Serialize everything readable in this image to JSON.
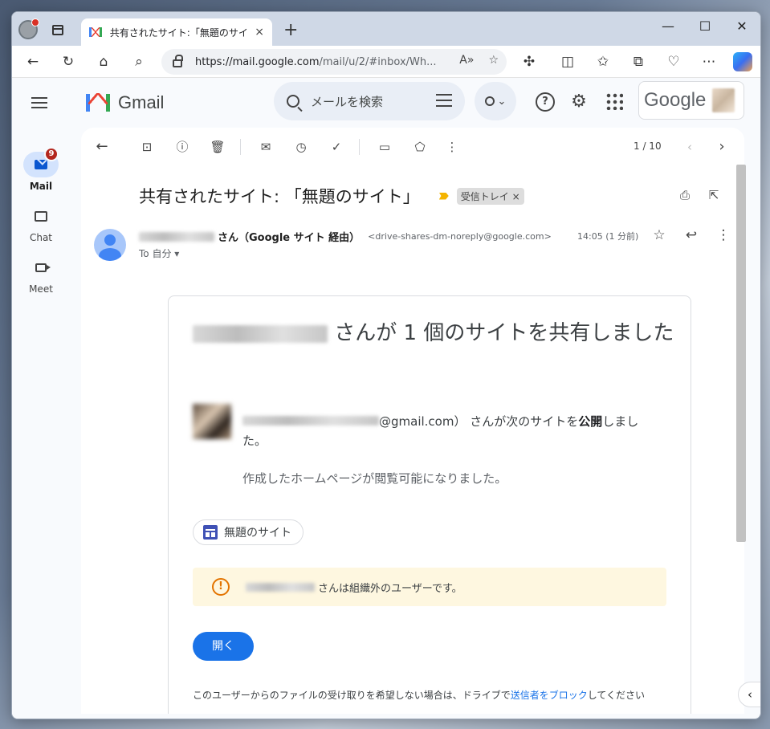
{
  "browser": {
    "tab_title": "共有されたサイト:「無題のサイト」- a",
    "tab_close": "×",
    "new_tab": "+",
    "url_host": "https://mail.google.com",
    "url_path": "/mail/u/2/#inbox/Wh...",
    "window_controls": {
      "minimize": "—",
      "maximize": "☐",
      "close": "✕"
    }
  },
  "rail": {
    "items": [
      {
        "label": "Mail",
        "badge": "9"
      },
      {
        "label": "Chat"
      },
      {
        "label": "Meet"
      }
    ]
  },
  "header": {
    "app_name": "Gmail",
    "search_placeholder": "メールを検索",
    "google_word": "Google"
  },
  "toolbar": {
    "pager": "1 / 10"
  },
  "email": {
    "subject": "共有されたサイト: 「無題のサイト」",
    "label": "受信トレイ",
    "label_close": "×",
    "sender_suffix": "さん（Google サイト 経由）",
    "sender_email": "<drive-shares-dm-noreply@google.com>",
    "time": "14:05 (1 分前)",
    "to": "To 自分 ▾",
    "body": {
      "headline_suffix": "さんが 1 個のサイトを共有しました",
      "share_email_suffix": "@gmail.com）",
      "share_text_before": "さんが次のサイトを",
      "share_text_bold": "公開",
      "share_text_after": "しました。",
      "note": "作成したホームページが閲覧可能になりました。",
      "site_chip": "無題のサイト",
      "warning": "さんは組織外のユーザーです。",
      "open_button": "開く",
      "footer_before": "このユーザーからのファイルの受け取りを希望しない場合は、ドライブで",
      "footer_link": "送信者をブロック",
      "footer_after": "してください"
    }
  },
  "colors": {
    "accent": "#1a73e8",
    "badge": "#b3261e",
    "warning_bg": "#fef7e0",
    "warning_icon": "#e37400"
  }
}
